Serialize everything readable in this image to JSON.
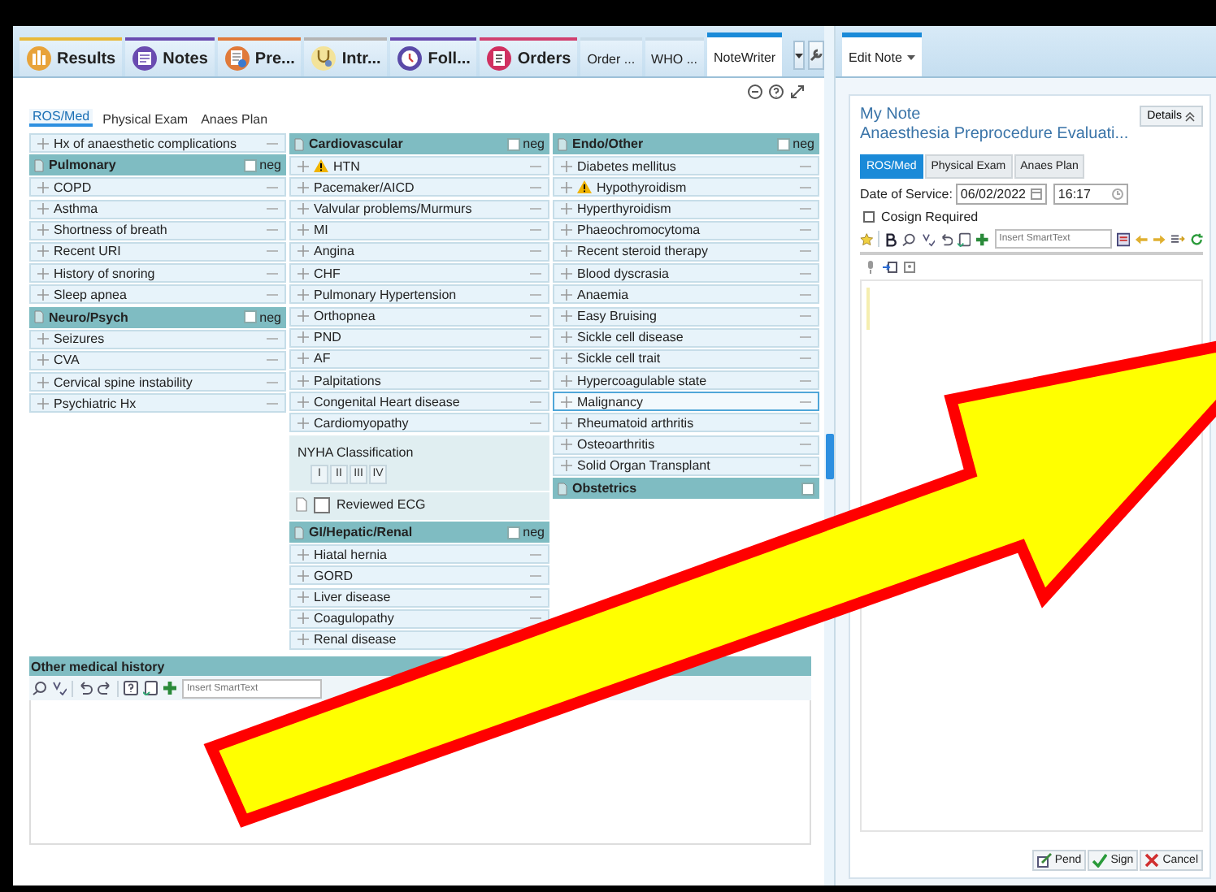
{
  "top_tabs": [
    {
      "label": "Results",
      "kind": "icon",
      "color": "#e8b93a",
      "selected": false
    },
    {
      "label": "Notes",
      "kind": "icon",
      "color": "#6a4bb0",
      "selected": false
    },
    {
      "label": "Pre...",
      "kind": "icon",
      "color": "#e07a3a",
      "selected": false
    },
    {
      "label": "Intr...",
      "kind": "icon",
      "color": "#b4b4b4",
      "selected": false
    },
    {
      "label": "Foll...",
      "kind": "icon",
      "color": "#6a4bb0",
      "selected": false
    },
    {
      "label": "Orders",
      "kind": "icon",
      "color": "#d04070",
      "selected": false
    },
    {
      "label": "Order ...",
      "kind": "text",
      "selected": false
    },
    {
      "label": "WHO ...",
      "kind": "text",
      "selected": false
    },
    {
      "label": "NoteWriter",
      "kind": "text",
      "selected": true
    }
  ],
  "section_tabs": [
    {
      "label": "ROS/Med",
      "selected": true
    },
    {
      "label": "Physical Exam",
      "selected": false
    },
    {
      "label": "Anaes Plan",
      "selected": false
    }
  ],
  "columns": [
    [
      {
        "kind": "item",
        "label": "Hx of anaesthetic complications",
        "warning": false,
        "selected": false
      },
      {
        "kind": "header",
        "title": "Pulmonary",
        "neg_label": "neg",
        "checked": false
      },
      {
        "kind": "item",
        "label": "COPD",
        "warning": false,
        "selected": false
      },
      {
        "kind": "item",
        "label": "Asthma",
        "warning": false,
        "selected": false
      },
      {
        "kind": "item",
        "label": "Shortness of breath",
        "warning": false,
        "selected": false
      },
      {
        "kind": "item",
        "label": "Recent URI",
        "warning": false,
        "selected": false
      },
      {
        "kind": "item",
        "label": "History of snoring",
        "warning": false,
        "selected": false
      },
      {
        "kind": "item",
        "label": "Sleep apnea",
        "warning": false,
        "selected": false
      },
      {
        "kind": "header",
        "title": "Neuro/Psych",
        "neg_label": "neg",
        "checked": false
      },
      {
        "kind": "item",
        "label": "Seizures",
        "warning": false,
        "selected": false
      },
      {
        "kind": "item",
        "label": "CVA",
        "warning": false,
        "selected": false
      },
      {
        "kind": "item",
        "label": "Cervical spine instability",
        "warning": false,
        "selected": false
      },
      {
        "kind": "item",
        "label": "Psychiatric Hx",
        "warning": false,
        "selected": false
      }
    ],
    [
      {
        "kind": "header",
        "title": "Cardiovascular",
        "neg_label": "neg",
        "checked": false
      },
      {
        "kind": "item",
        "label": "HTN",
        "warning": true,
        "selected": false
      },
      {
        "kind": "item",
        "label": "Pacemaker/AICD",
        "warning": false,
        "selected": false
      },
      {
        "kind": "item",
        "label": "Valvular problems/Murmurs",
        "warning": false,
        "selected": false
      },
      {
        "kind": "item",
        "label": "MI",
        "warning": false,
        "selected": false
      },
      {
        "kind": "item",
        "label": "Angina",
        "warning": false,
        "selected": false
      },
      {
        "kind": "item",
        "label": "CHF",
        "warning": false,
        "selected": false
      },
      {
        "kind": "item",
        "label": "Pulmonary Hypertension",
        "warning": false,
        "selected": false
      },
      {
        "kind": "item",
        "label": "Orthopnea",
        "warning": false,
        "selected": false
      },
      {
        "kind": "item",
        "label": "PND",
        "warning": false,
        "selected": false
      },
      {
        "kind": "item",
        "label": "AF",
        "warning": false,
        "selected": false
      },
      {
        "kind": "item",
        "label": "Palpitations",
        "warning": false,
        "selected": false
      },
      {
        "kind": "item",
        "label": "Congenital Heart disease",
        "warning": false,
        "selected": false
      },
      {
        "kind": "item",
        "label": "Cardiomyopathy",
        "warning": false,
        "selected": false
      },
      {
        "kind": "grades",
        "label": "NYHA Classification",
        "options": [
          {
            "label": "I",
            "selected": false
          },
          {
            "label": "II",
            "selected": false
          },
          {
            "label": "III",
            "selected": false
          },
          {
            "label": "IV",
            "selected": false
          }
        ]
      },
      {
        "kind": "check",
        "label": "Reviewed ECG",
        "checked": false
      },
      {
        "kind": "header",
        "title": "GI/Hepatic/Renal",
        "neg_label": "neg",
        "checked": false
      },
      {
        "kind": "item",
        "label": "Hiatal hernia",
        "warning": false,
        "selected": false
      },
      {
        "kind": "item",
        "label": "GORD",
        "warning": false,
        "selected": false
      },
      {
        "kind": "item",
        "label": "Liver disease",
        "warning": false,
        "selected": false
      },
      {
        "kind": "item",
        "label": "Coagulopathy",
        "warning": false,
        "selected": false
      },
      {
        "kind": "item",
        "label": "Renal disease",
        "warning": false,
        "selected": false
      }
    ],
    [
      {
        "kind": "header",
        "title": "Endo/Other",
        "neg_label": "neg",
        "checked": false
      },
      {
        "kind": "item",
        "label": "Diabetes mellitus",
        "warning": false,
        "selected": false
      },
      {
        "kind": "item",
        "label": "Hypothyroidism",
        "warning": true,
        "selected": false
      },
      {
        "kind": "item",
        "label": "Hyperthyroidism",
        "warning": false,
        "selected": false
      },
      {
        "kind": "item",
        "label": "Phaeochromocytoma",
        "warning": false,
        "selected": false
      },
      {
        "kind": "item",
        "label": "Recent steroid therapy",
        "warning": false,
        "selected": false
      },
      {
        "kind": "item",
        "label": "Blood dyscrasia",
        "warning": false,
        "selected": false
      },
      {
        "kind": "item",
        "label": "Anaemia",
        "warning": false,
        "selected": false
      },
      {
        "kind": "item",
        "label": "Easy Bruising",
        "warning": false,
        "selected": false
      },
      {
        "kind": "item",
        "label": "Sickle cell disease",
        "warning": false,
        "selected": false
      },
      {
        "kind": "item",
        "label": "Sickle cell trait",
        "warning": false,
        "selected": false
      },
      {
        "kind": "item",
        "label": "Hypercoagulable state",
        "warning": false,
        "selected": false
      },
      {
        "kind": "item",
        "label": "Malignancy",
        "warning": false,
        "selected": true
      },
      {
        "kind": "item",
        "label": "Rheumatoid arthritis",
        "warning": false,
        "selected": false
      },
      {
        "kind": "item",
        "label": "Osteoarthritis",
        "warning": false,
        "selected": false
      },
      {
        "kind": "item",
        "label": "Solid Organ Transplant",
        "warning": false,
        "selected": false
      },
      {
        "kind": "header",
        "title": "Obstetrics",
        "checked": false
      }
    ]
  ],
  "other_history": {
    "title": "Other medical history",
    "placeholder": "Insert SmartText"
  },
  "side_tab": {
    "label": "Edit Note"
  },
  "editor": {
    "title": "My Note",
    "subtitle": "Anaesthesia Preprocedure Evaluati...",
    "details_label": "Details",
    "tabs": [
      {
        "label": "ROS/Med",
        "selected": true
      },
      {
        "label": "Physical Exam",
        "selected": false
      },
      {
        "label": "Anaes Plan",
        "selected": false
      }
    ],
    "date_label": "Date of Service:",
    "date": "06/02/2022",
    "time": "16:17",
    "cosign": {
      "label": "Cosign Required",
      "checked": false
    },
    "placeholder": "Insert SmartText",
    "buttons": [
      {
        "label": "Pend",
        "kind": "pend"
      },
      {
        "label": "Sign",
        "kind": "sign"
      },
      {
        "label": "Cancel",
        "kind": "cancel"
      }
    ]
  }
}
